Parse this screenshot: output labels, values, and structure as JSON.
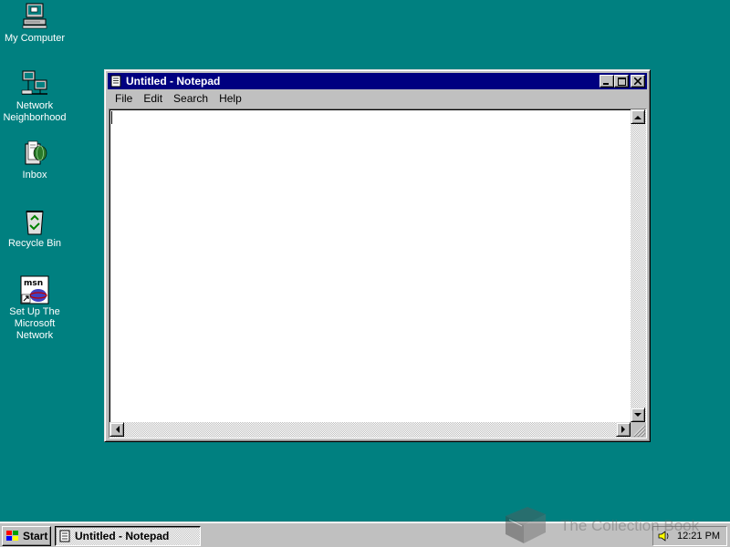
{
  "desktop": {
    "background_color": "#008080",
    "icons": [
      {
        "label": "My Computer",
        "icon": "my-computer-icon"
      },
      {
        "label": "Network\nNeighborhood",
        "icon": "network-neighborhood-icon"
      },
      {
        "label": "Inbox",
        "icon": "inbox-icon"
      },
      {
        "label": "Recycle Bin",
        "icon": "recycle-bin-icon"
      },
      {
        "label": "Set Up The\nMicrosoft\nNetwork",
        "icon": "msn-setup-icon"
      }
    ]
  },
  "window": {
    "title": "Untitled - Notepad",
    "titlebar_color": "#000080",
    "menu": [
      {
        "label": "File"
      },
      {
        "label": "Edit"
      },
      {
        "label": "Search"
      },
      {
        "label": "Help"
      }
    ],
    "content": ""
  },
  "taskbar": {
    "start_label": "Start",
    "task_button_label": "Untitled - Notepad",
    "clock": "12:21 PM"
  },
  "watermark": {
    "text": "The Collection Book"
  }
}
